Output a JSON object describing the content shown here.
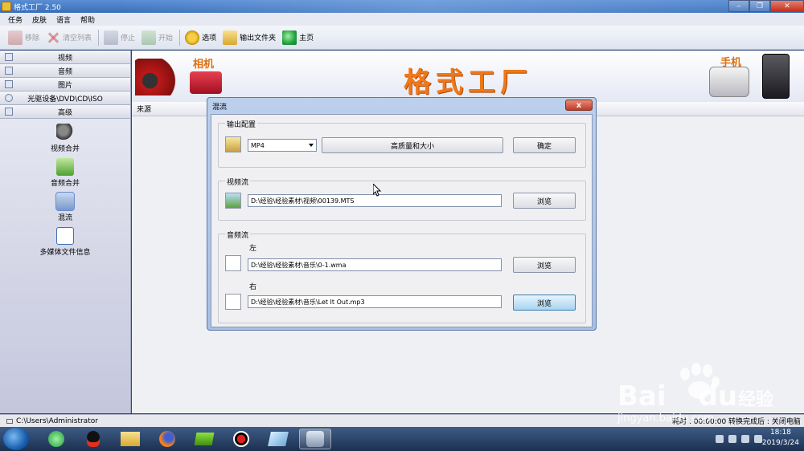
{
  "window": {
    "title": "格式工厂  2.50"
  },
  "menubar": [
    "任务",
    "皮肤",
    "语言",
    "帮助"
  ],
  "toolbar": {
    "remove": "移除",
    "clear_list": "清空列表",
    "stop": "停止",
    "start": "开始",
    "options": "选项",
    "output_folder": "输出文件夹",
    "home": "主页"
  },
  "sidebar": {
    "categories": [
      "视频",
      "音频",
      "图片",
      "光驱设备\\DVD\\CD\\ISO",
      "高级"
    ],
    "tools": [
      "视频合并",
      "音频合并",
      "混流",
      "多媒体文件信息"
    ]
  },
  "banner": {
    "camera_label": "相机",
    "title": "格式工厂",
    "phone_label": "手机"
  },
  "list": {
    "source_header": "来源"
  },
  "dialog": {
    "title": "混流",
    "close": "x",
    "output_group": "输出配置",
    "format": "MP4",
    "quality": "高质量和大小",
    "ok": "确定",
    "video_group": "视频流",
    "video_path": "D:\\经验\\经验素材\\视频\\00139.MTS",
    "browse": "浏览",
    "audio_group": "音频流",
    "left_label": "左",
    "left_path": "D:\\经验\\经验素材\\音乐\\0-1.wma",
    "right_label": "右",
    "right_path": "D:\\经验\\经验素材\\音乐\\Let It Out.mp3"
  },
  "statusbar": {
    "path": "C:\\Users\\Administrator",
    "elapsed": "耗时 : 00:00:00",
    "after_done": "转换完成后 : 关闭电脑"
  },
  "taskbar": {
    "time": "18:18",
    "date": "2019/3/24"
  },
  "watermark": {
    "brand": "Bai",
    "brand2": "du",
    "cn": "经验",
    "url": "jingyan.baidu.com"
  }
}
